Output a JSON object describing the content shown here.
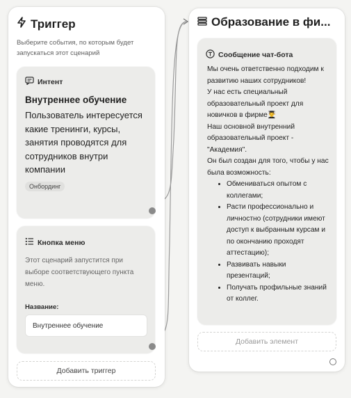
{
  "trigger_panel": {
    "title": "Триггер",
    "description": "Выберите события, по которым будет запускаться этот сценарий",
    "intent_card": {
      "header": "Интент",
      "title": "Внутреннее обучение",
      "body": "Пользователь интересуется какие тренинги, курсы, занятия проводятся для сотрудников внутри компании",
      "tag": "Онбординг"
    },
    "menu_card": {
      "header": "Кнопка меню",
      "body": "Этот сценарий запустится при выборе соответствующего пункта меню.",
      "field_label": "Название:",
      "field_value": "Внутреннее обучение"
    },
    "add_trigger_label": "Добавить триггер"
  },
  "scenario_panel": {
    "title": "Образование в фи...",
    "message": {
      "header": "Сообщение чат-бота",
      "paragraphs": [
        "Мы очень ответственно подходим к развитию наших сотрудников!",
        "У нас есть специальный образовательный проект для новичков в фирме👨‍🎓",
        "Наш основной внутренний образовательный проект - \"Академия\".",
        "Он был создан для того, чтобы у нас была возможность:"
      ],
      "bullets": [
        "Обмениваться опытом с коллегами;",
        "Расти профессионально и личностно (сотрудники имеют доступ к выбранным курсам и по окончанию проходят аттестацию);",
        "Развивать навыки презентаций;",
        "Получать профильные знаний от коллег."
      ]
    },
    "add_element_label": "Добавить элемент"
  },
  "icons": {
    "trigger": "lightning-icon",
    "scenario": "list-icon",
    "intent": "chat-bubble-icon",
    "menu": "menu-list-icon",
    "message": "text-t-icon"
  },
  "colors": {
    "background": "#f4f4f2",
    "card": "#ececea",
    "port": "#8a8a8a"
  }
}
